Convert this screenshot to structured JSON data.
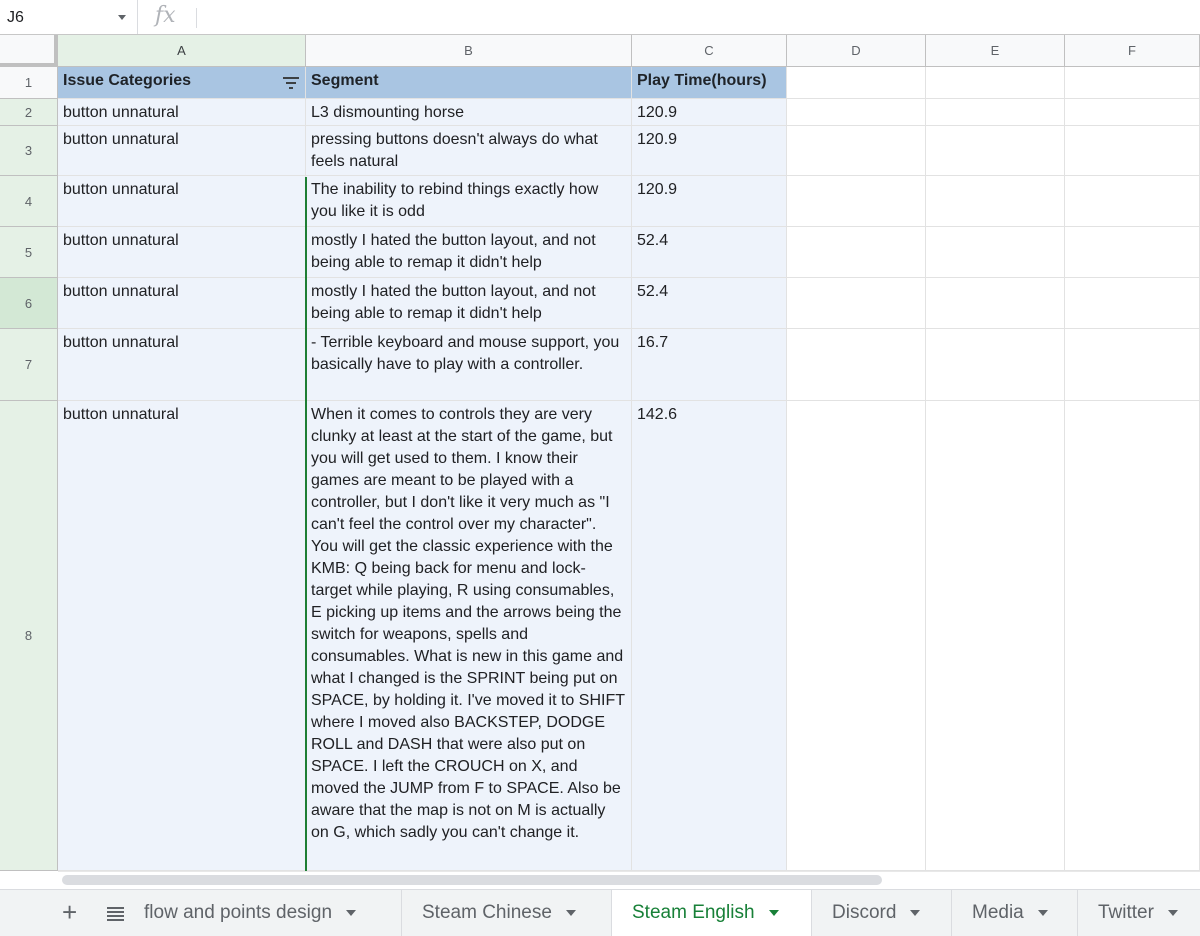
{
  "formula_bar": {
    "cell_ref": "J6",
    "fx_label": "fx",
    "formula": ""
  },
  "columns": [
    "A",
    "B",
    "C",
    "D",
    "E",
    "F"
  ],
  "rows": [
    {
      "num": "1",
      "a": "Issue Categories",
      "b": "Segment",
      "c": "Play Time(hours)"
    },
    {
      "num": "2",
      "a": "button unnatural",
      "b": "L3 dismounting horse",
      "c": "120.9"
    },
    {
      "num": "3",
      "a": "button unnatural",
      "b": "pressing buttons doesn't always do what feels natural",
      "c": "120.9"
    },
    {
      "num": "4",
      "a": "button unnatural",
      "b": "The inability to rebind things exactly how you like it is odd",
      "c": "120.9"
    },
    {
      "num": "5",
      "a": "button unnatural",
      "b": "mostly I hated the button layout, and not being able to remap it didn't help",
      "c": "52.4"
    },
    {
      "num": "6",
      "a": "button unnatural",
      "b": "mostly I hated the button layout, and not being able to remap it didn't help",
      "c": "52.4"
    },
    {
      "num": "7",
      "a": "button unnatural",
      "b": "- Terrible keyboard and mouse support, you basically have to play with a controller.",
      "c": "16.7"
    },
    {
      "num": "8",
      "a": "button unnatural",
      "b": "When it comes to controls they are very clunky at least at the start of the game, but you will get used to them. I know their games are meant to be played with a controller, but I don't like it very much as \"I can't feel the control over my character\". You will get the classic experience with the KMB: Q being back for menu and lock-target while playing, R using consumables, E picking up items and the arrows being the switch for weapons, spells and consumables. What is new in this game and what I changed is the SPRINT being put on SPACE, by holding it. I've moved it to SHIFT where I moved also BACKSTEP, DODGE ROLL and DASH that were also put on SPACE. I left the CROUCH on X, and moved the JUMP from F to SPACE. Also be aware that the map is not on M is actually on G, which sadly you can't change it.",
      "c": "142.6"
    }
  ],
  "sheet_tabs": [
    {
      "label": "flow and points design",
      "active": false
    },
    {
      "label": "Steam Chinese",
      "active": false
    },
    {
      "label": "Steam English",
      "active": true
    },
    {
      "label": "Discord",
      "active": false
    },
    {
      "label": "Media",
      "active": false
    },
    {
      "label": "Twitter",
      "active": false
    }
  ],
  "colors": {
    "header_fill": "#a9c5e2",
    "tint_fill": "#eef3fb",
    "selection_green": "#1e7e34",
    "active_tab": "#188038"
  }
}
